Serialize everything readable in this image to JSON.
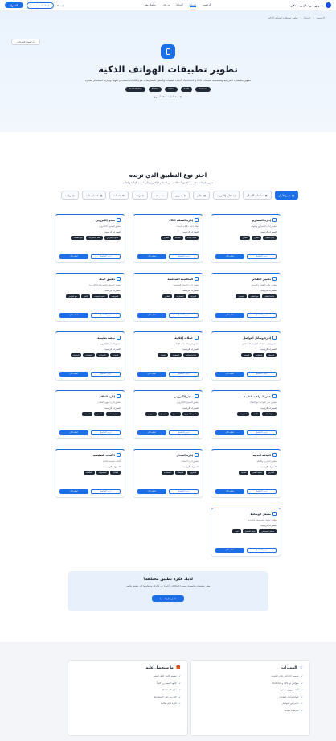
{
  "topbar": {
    "brand": "تسويق سوشيال ويب ذكي",
    "nav": [
      "الرئيسية",
      "خدماتنا",
      "أعمالنا",
      "من نحن",
      "تواصل معنا"
    ],
    "nav_active_index": 1,
    "cart_label": "0",
    "register_label": "إنشاء حساب جديد",
    "login_label": "الدخول"
  },
  "hero": {
    "breadcrumb": [
      "الرئيسية",
      "خدماتنا",
      "تطوير تطبيقات الهواتف الذكية"
    ],
    "back_label": "العودة للخدمات",
    "title": "تطوير تطبيقات الهواتف الذكية",
    "subtitle": "تطوير تطبيقات احترافية ومخصصة لمنصات iOS و Android بأحدث التقنيات وأفضل الممارسات مع إمكانيات استخدام سهلة وتجربة استخدام ممتازة",
    "tech": [
      "React Native",
      "Flutter",
      "Kotlin",
      "Swift",
      "Firebase"
    ],
    "duration": "مدة التنفيذ: 4-12 أسبوع"
  },
  "types": {
    "title": "اختر نوع التطبيق الذي تريده",
    "subtitle": "نطور تطبيقات متخصصة لجميع المجالات - من المتاجر الإلكترونية إلى أنظمة الإدارة والتعليم",
    "filters": [
      "جميع الأنواع",
      "تطبيقات الأعمال",
      "تجارة إلكترونية",
      "تعليم",
      "تسويق",
      "صحة",
      "ترفيه",
      "خدمات",
      "خدمات عامة",
      "رياضة"
    ],
    "card_label": "المميزات الرئيسية:",
    "more_label": "عرض التفاصيل",
    "order_label": "اطلب الآن",
    "cards": [
      {
        "title": "إدارة المشاريع",
        "desc": "تطبيق إدارة المشاريع والمهام",
        "tags": [
          "إدارة المهام",
          "التقارير",
          "التعاون"
        ]
      },
      {
        "title": "إدارة العملاء CRM",
        "desc": "نظام إدارة علاقات العملاء",
        "tags": [
          "قاعدة بيانات",
          "المتابعة",
          "التقارير"
        ]
      },
      {
        "title": "متجر إلكتروني",
        "desc": "تطبيق للتسوق الإلكتروني",
        "tags": [
          "الدفع الإلكتروني",
          "سلة المشتريات",
          "تتبع الطلبات"
        ]
      },
      {
        "title": "تطبيق الطعام",
        "desc": "تطبيق طلب الطعام والتوصيل",
        "tags": [
          "قائمة الطعام",
          "تتبع الطلب",
          "التوصيل"
        ]
      },
      {
        "title": "المحاسبة الشخصية",
        "desc": "تطبيق إدارة الأموال الشخصية",
        "tags": [
          "الميزانية",
          "المصاريف",
          "التقارير"
        ]
      },
      {
        "title": "تطبيق البنك",
        "desc": "تطبيق الخدمات المصرفية الإلكترونية",
        "tags": [
          "التحويلات",
          "كشف الحساب",
          "الأمان",
          "دفع الفواتير"
        ]
      },
      {
        "title": "إدارة وسائل التواصل",
        "desc": "تطبيق إدارة حسابات التواصل الاجتماعي",
        "tags": [
          "الجدولة",
          "التحليلات",
          "المحتوى"
        ]
      },
      {
        "title": "حملات إعلانية",
        "desc": "تطبيق إدارة الحملات الإعلانية",
        "tags": [
          "إنشاء الحملات",
          "الاستهداف",
          "التحليل"
        ]
      },
      {
        "title": "منصة تعليمية",
        "desc": "تطبيق التعليم الإلكتروني",
        "tags": [
          "الدورات",
          "الاختبارات",
          "الشهادات",
          "الواجبات"
        ]
      },
      {
        "title": "حجز المواعيد الطبية",
        "desc": "تطبيق حجز المواعيد مع الأطباء",
        "tags": [
          "حجز المواعيد",
          "الأطباء",
          "التذكيرات"
        ]
      },
      {
        "title": "متجر إلكتروني",
        "desc": "تطبيق للتسوق الإلكتروني",
        "tags": [
          "الدفع الإلكتروني",
          "التسوق",
          "التوصيل",
          "العروض"
        ]
      },
      {
        "title": "إدارة الطلاب",
        "desc": "تطبيق إدارة شؤون الطلاب",
        "tags": [
          "سجل الطلاب",
          "الحضور",
          "الدرجات"
        ]
      },
      {
        "title": "اللياقة البدنية",
        "desc": "تطبيق التمارين واللياقة",
        "tags": [
          "التمارين",
          "متابعة التقدم",
          "التغذية"
        ]
      },
      {
        "title": "إدارة المحال",
        "desc": "تطبيق إدارة المحلات",
        "tags": [
          "المخزون",
          "المبيعات",
          "الحسابات"
        ]
      },
      {
        "title": "الألعاب التعليمية",
        "desc": "ألعاب تعليمية تفاعلية",
        "tags": [
          "التفاعل",
          "المستويات",
          "المكافآت"
        ]
      },
      {
        "title": "مشغل الوسائط",
        "desc": "تطبيق تشغيل الموسيقى والفيديو",
        "tags": [
          "مشغل الموسيقى",
          "قوائم التشغيل",
          "البث"
        ]
      }
    ]
  },
  "cta": {
    "title": "لديك فكرة تطبيق مختلفة؟",
    "subtitle": "نطور تطبيقات مخصصة حسب احتياجاتك - أخبرنا عن فكرتك وسنحولها إلى تطبيق واقعي",
    "button": "ناقش فكرتك معنا"
  },
  "features": {
    "title": "المميزات",
    "items": [
      "تصميم احترافي عالي الجودة",
      "متوافق مع iOS و Android",
      "أداء سريع ومستقر",
      "حماية وأمان للبيانات",
      "دعم فني متواصل",
      "تحديثات مجانية"
    ]
  },
  "deliverables": {
    "title": "ما ستحصل عليه",
    "items": [
      "تطبيق كامل جاهز للنشر",
      "الكود المصدري كاملاً",
      "دليل الاستخدام",
      "التدريب على الاستخدام",
      "فترة دعم مجانية"
    ]
  },
  "colors": {
    "accent": "#1d6fe8",
    "hero_bg": "#eaf3fd",
    "tag_bg": "#1f2937"
  }
}
